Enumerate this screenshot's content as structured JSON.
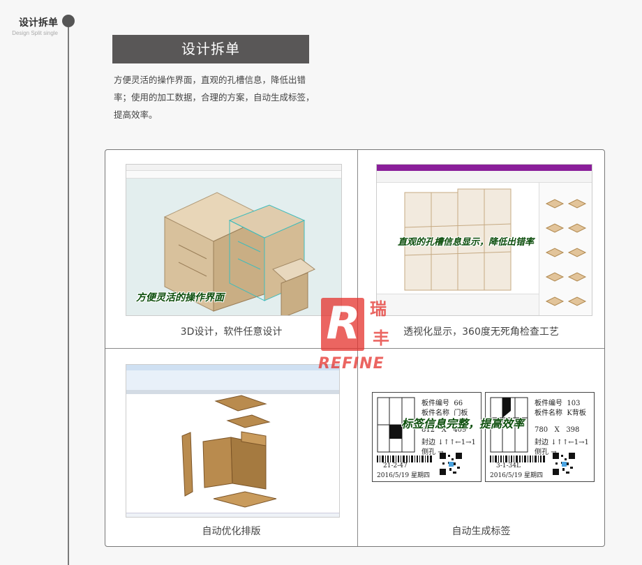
{
  "section": {
    "side_title": "设计拆单",
    "side_subtitle": "Design Split single",
    "banner_title": "设计拆单",
    "description": "方便灵活的操作界面，直观的孔槽信息，降低出错率；使用的加工数据，合理的方案，自动生成标签，提高效率。"
  },
  "cells": [
    {
      "caption": "3D设计，软件任意设计",
      "overlay": "方便灵活的操作界面"
    },
    {
      "caption": "透视化显示，360度无死角检查工艺",
      "overlay": "直观的孔槽信息显示，降低出错率"
    },
    {
      "caption": "自动优化排版",
      "overlay": ""
    },
    {
      "caption": "自动生成标签",
      "overlay": "标签信息完整，提高效率"
    }
  ],
  "logo": {
    "cn_top": "瑞",
    "cn_bottom": "丰",
    "en": "REFINE",
    "mark": "R"
  },
  "labels": [
    {
      "no_label": "板件编号",
      "no_value": "66",
      "name_label": "板件名称",
      "name_value": "门板",
      "size_a": "812",
      "x": "X",
      "size_b": "409",
      "edge_label": "封边",
      "edge_value": "↓↑↑←1→1",
      "hole_label": "侧孔",
      "hole_value": "→",
      "code": "21-2-47",
      "date": "2016/5/19 星期四"
    },
    {
      "no_label": "板件编号",
      "no_value": "103",
      "name_label": "板件名称",
      "name_value": "K背板",
      "size_a": "780",
      "x": "X",
      "size_b": "398",
      "edge_label": "封边",
      "edge_value": "↓↑↑←1→1",
      "hole_label": "侧孔",
      "hole_value": "→",
      "code": "3-1-34L",
      "date": "2016/5/19 星期四"
    }
  ],
  "colors": {
    "banner": "#595757",
    "overlay_text": "#0c4e0c",
    "logo_red": "#e5322d",
    "title_bar_purple": "#8a1e9a"
  }
}
